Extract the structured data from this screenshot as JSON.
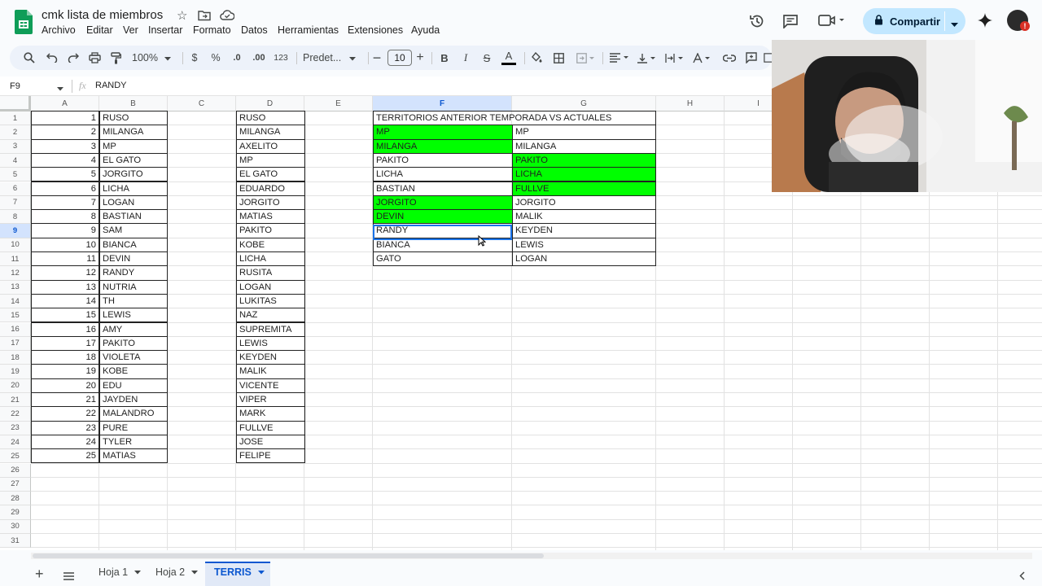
{
  "doc": {
    "title": "cmk lista de miembros",
    "menus": [
      "Archivo",
      "Editar",
      "Ver",
      "Insertar",
      "Formato",
      "Datos",
      "Herramientas",
      "Extensiones",
      "Ayuda"
    ],
    "share_label": "Compartir"
  },
  "toolbar": {
    "zoom": "100%",
    "currency": "$",
    "percent": "%",
    "dec_less": ".0",
    "dec_more": ".00",
    "number_format": "123",
    "font": "Predet...",
    "font_size": "10",
    "bold": "B",
    "italic": "I",
    "strike": "S",
    "text_color": "A"
  },
  "formula": {
    "cell_ref": "F9",
    "fx": "fx",
    "value": "RANDY"
  },
  "grid": {
    "columns": [
      "A",
      "B",
      "C",
      "D",
      "E",
      "F",
      "G",
      "H",
      "I"
    ],
    "rows": [
      "1",
      "2",
      "3",
      "4",
      "5",
      "6",
      "7",
      "8",
      "9",
      "10",
      "11",
      "12",
      "13",
      "14",
      "15",
      "16",
      "17",
      "18",
      "19",
      "20",
      "21",
      "22",
      "23",
      "24",
      "25",
      "26",
      "27",
      "28",
      "29",
      "30",
      "31"
    ],
    "col_a": [
      "1",
      "2",
      "3",
      "4",
      "5",
      "6",
      "7",
      "8",
      "9",
      "10",
      "11",
      "12",
      "13",
      "14",
      "15",
      "16",
      "17",
      "18",
      "19",
      "20",
      "21",
      "22",
      "23",
      "24",
      "25"
    ],
    "col_b": [
      "RUSO",
      "MILANGA",
      "MP",
      "EL GATO",
      "JORGITO",
      "LICHA",
      "LOGAN",
      "BASTIAN",
      "SAM",
      "BIANCA",
      "DEVIN",
      "RANDY",
      "NUTRIA",
      "TH",
      "LEWIS",
      "AMY",
      "PAKITO",
      "VIOLETA",
      "KOBE",
      "EDU",
      "JAYDEN",
      "MALANDRO",
      "PURE",
      "TYLER",
      "MATIAS"
    ],
    "col_d": [
      "RUSO",
      "MILANGA",
      "AXELITO",
      "MP",
      "EL GATO",
      "EDUARDO",
      "JORGITO",
      "MATIAS",
      "PAKITO",
      "KOBE",
      "LICHA",
      "RUSITA",
      "LOGAN",
      "LUKITAS",
      "NAZ",
      "SUPREMITA",
      "LEWIS",
      "KEYDEN",
      "MALIK",
      "VICENTE",
      "VIPER",
      "MARK",
      "FULLVE",
      "JOSE",
      "FELIPE"
    ],
    "header_fg": "TERRITORIOS ANTERIOR TEMPORADA VS ACTUALES",
    "col_f": [
      "MP",
      "MILANGA",
      "PAKITO",
      "LICHA",
      "BASTIAN",
      "JORGITO",
      "DEVIN",
      "RANDY",
      "BIANCA",
      "GATO"
    ],
    "col_g": [
      "MP",
      "MILANGA",
      "PAKITO",
      "LICHA",
      "FULLVE",
      "JORGITO",
      "MALIK",
      "KEYDEN",
      "LEWIS",
      "LOGAN"
    ],
    "col_f_green": [
      true,
      true,
      false,
      false,
      false,
      true,
      true,
      false,
      false,
      false
    ],
    "col_g_green": [
      false,
      false,
      true,
      true,
      true,
      false,
      false,
      false,
      false,
      false
    ],
    "highlight_color": "#00ff00"
  },
  "sheets": {
    "tabs": [
      "Hoja 1",
      "Hoja 2",
      "TERRIS"
    ],
    "active": "TERRIS"
  }
}
